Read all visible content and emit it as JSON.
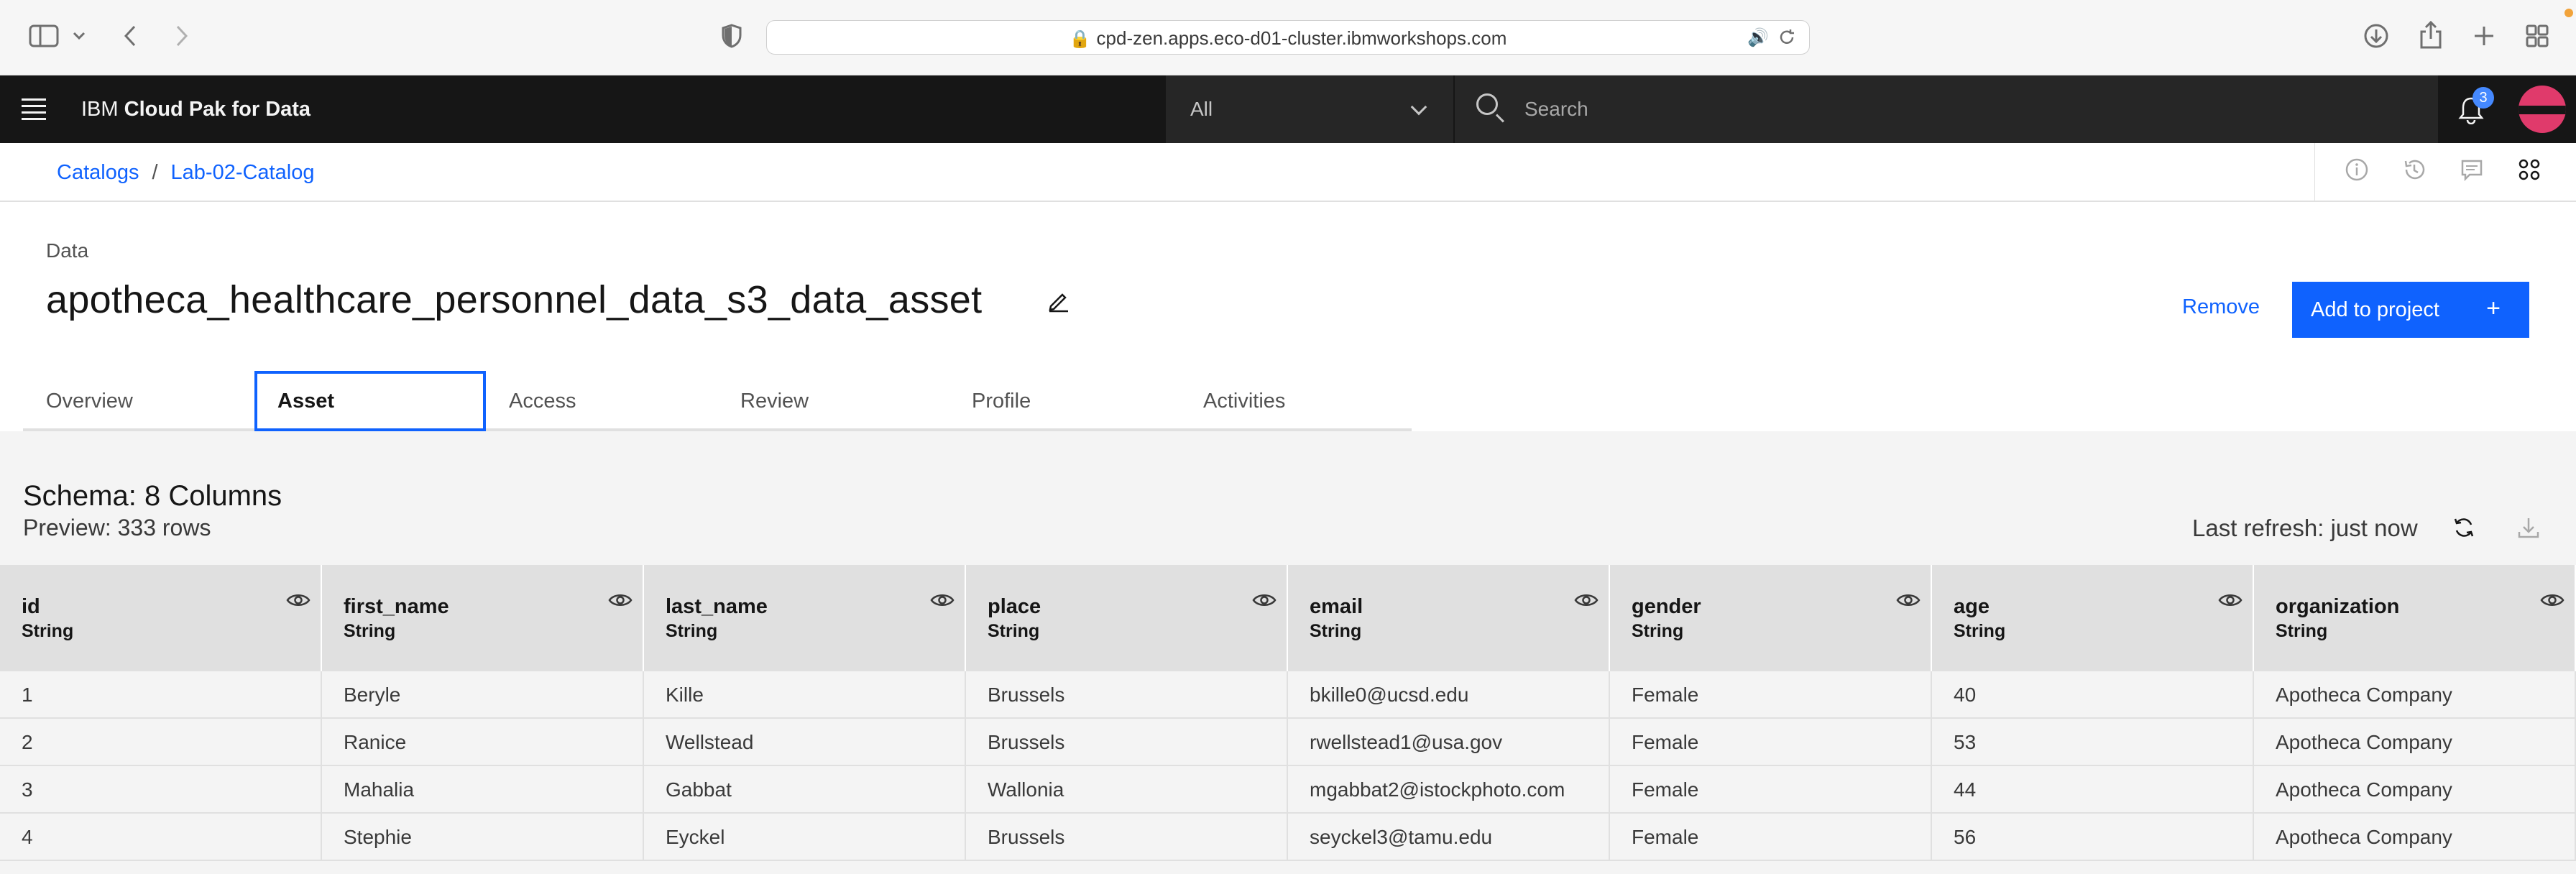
{
  "browser": {
    "url": "cpd-zen.apps.eco-d01-cluster.ibmworkshops.com"
  },
  "header": {
    "brand_prefix": "IBM",
    "brand_name": "Cloud Pak for Data",
    "scope": "All",
    "search_placeholder": "Search",
    "notification_count": "3"
  },
  "breadcrumb": {
    "root": "Catalogs",
    "separator": "/",
    "current": "Lab-02-Catalog"
  },
  "asset": {
    "type_label": "Data",
    "title": "apotheca_healthcare_personnel_data_s3_data_asset",
    "remove_label": "Remove",
    "add_label": "Add to project",
    "add_icon": "+"
  },
  "tabs": [
    {
      "label": "Overview"
    },
    {
      "label": "Asset"
    },
    {
      "label": "Access"
    },
    {
      "label": "Review"
    },
    {
      "label": "Profile"
    },
    {
      "label": "Activities"
    }
  ],
  "schema": {
    "title": "Schema:  8 Columns",
    "preview": "Preview: 333 rows",
    "last_refresh": "Last refresh: just now"
  },
  "table": {
    "columns": [
      {
        "name": "id",
        "type": "String"
      },
      {
        "name": "first_name",
        "type": "String"
      },
      {
        "name": "last_name",
        "type": "String"
      },
      {
        "name": "place",
        "type": "String"
      },
      {
        "name": "email",
        "type": "String"
      },
      {
        "name": "gender",
        "type": "String"
      },
      {
        "name": "age",
        "type": "String"
      },
      {
        "name": "organization",
        "type": "String"
      }
    ],
    "rows": [
      [
        "1",
        "Beryle",
        "Kille",
        "Brussels",
        "bkille0@ucsd.edu",
        "Female",
        "40",
        "Apotheca Company"
      ],
      [
        "2",
        "Ranice",
        "Wellstead",
        "Brussels",
        "rwellstead1@usa.gov",
        "Female",
        "53",
        "Apotheca Company"
      ],
      [
        "3",
        "Mahalia",
        "Gabbat",
        "Wallonia",
        "mgabbat2@istockphoto.com",
        "Female",
        "44",
        "Apotheca Company"
      ],
      [
        "4",
        "Stephie",
        "Eyckel",
        "Brussels",
        "seyckel3@tamu.edu",
        "Female",
        "56",
        "Apotheca Company"
      ]
    ]
  },
  "colors": {
    "accent": "#0f62fe",
    "header_bg": "#161616",
    "avatar": "#e03a6b"
  }
}
